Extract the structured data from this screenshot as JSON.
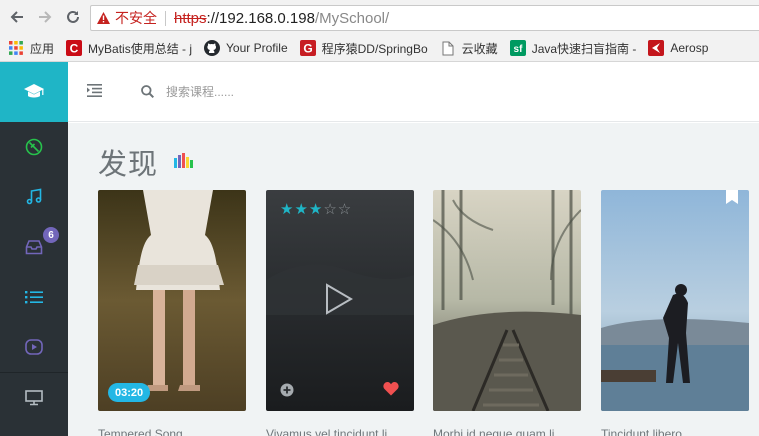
{
  "browser": {
    "security_label": "不安全",
    "url_scheme": "https",
    "url_host": "://192.168.0.198",
    "url_path": "/MySchool/",
    "bookmarks": [
      {
        "label": "应用",
        "icon": "apps-grid-icon"
      },
      {
        "label": "MyBatis使用总结 - j",
        "icon": "csdn-icon"
      },
      {
        "label": "Your Profile",
        "icon": "github-icon"
      },
      {
        "label": "程序猿DD/SpringBo",
        "icon": "gitee-icon"
      },
      {
        "label": "云收藏",
        "icon": "page-icon"
      },
      {
        "label": "Java快速扫盲指南 - ",
        "icon": "segmentfault-icon"
      },
      {
        "label": "Aerosp",
        "icon": "aerospike-icon"
      }
    ]
  },
  "app": {
    "accent_color": "#1fb5c6",
    "sidebar": {
      "inbox_badge": "6",
      "items": [
        "compass-icon",
        "music-note-icon",
        "inbox-icon",
        "list-icon",
        "play-circle-icon"
      ],
      "bottom_item": "monitor-icon"
    },
    "search": {
      "placeholder": "搜索课程......"
    },
    "page_title": "发现",
    "cards": [
      {
        "caption": "Tempered Song",
        "duration": "03:20"
      },
      {
        "caption": "Vivamus vel tincidunt li",
        "rating": 3,
        "rating_max": 5
      },
      {
        "caption": "Morbi id neque quam li"
      },
      {
        "caption": "Tincidunt libero"
      }
    ]
  }
}
